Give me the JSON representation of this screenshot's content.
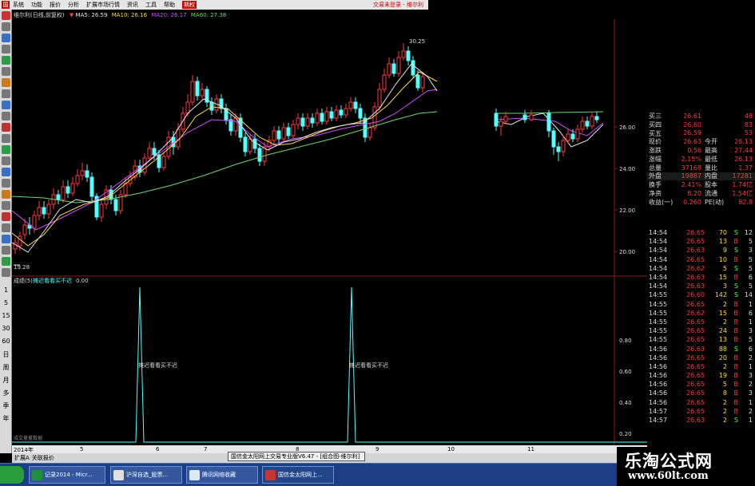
{
  "menubar": {
    "items": [
      "系统",
      "功能",
      "报价",
      "分析",
      "扩展市场行情",
      "资讯",
      "工具",
      "帮助",
      "期权"
    ],
    "right_text": "交易未登录 - 维尔利"
  },
  "chart_header": {
    "title": "维尔利(日线,前复权)",
    "ma5": "MA5: 26.59",
    "ma10": "MA10: 26.16",
    "ma20": "MA20: 26.17",
    "ma60": "MA60: 27.38"
  },
  "price_labels": {
    "high": "30.25",
    "low": "19.28"
  },
  "price_axis": [
    "26.00",
    "24.00",
    "22.00",
    "20.00"
  ],
  "indicator": {
    "header_name": "成绩(5)",
    "header_label": "摊迟看看买不迟",
    "header_value": "0.00",
    "annotation_1": "摊迟看看买不迟",
    "annotation_2": "摊迟看看买不迟",
    "axis": [
      "0.80",
      "0.60",
      "0.40",
      "0.20"
    ],
    "footer_text": "成交量量数据"
  },
  "left_periods": [
    "1",
    "5",
    "15",
    "30",
    "60",
    "日",
    "周",
    "月",
    "多",
    "季",
    "年"
  ],
  "period_tabs": [
    "2014年",
    "5",
    "6",
    "7",
    "8",
    "9",
    "10",
    "11"
  ],
  "status": {
    "left": "扩展A",
    "left2": "关联报价",
    "popup": "国信金太阳网上交易专业版V6.47 - [组合图-维尔利]"
  },
  "quote_rows": [
    {
      "label": "买三",
      "value": "26.61",
      "extra_label": "",
      "extra": "48"
    },
    {
      "label": "买四",
      "value": "26.60",
      "extra_label": "",
      "extra": "83"
    },
    {
      "label": "买五",
      "value": "26.59",
      "extra_label": "",
      "extra": "53"
    },
    {
      "label": "现价",
      "value": "26.63",
      "extra_label": "今开",
      "extra": "26.13"
    },
    {
      "label": "涨跌",
      "value": "0.56",
      "extra_label": "最高",
      "extra": "27.44"
    },
    {
      "label": "涨幅",
      "value": "2.15%",
      "extra_label": "最低",
      "extra": "26.13"
    },
    {
      "label": "总量",
      "value": "37168",
      "extra_label": "量比",
      "extra": "1.37"
    },
    {
      "label": "外盘",
      "value": "19887",
      "extra_label": "内盘",
      "extra": "17281"
    },
    {
      "label": "换手",
      "value": "2.41%",
      "extra_label": "股本",
      "extra": "1.74亿"
    },
    {
      "label": "净资",
      "value": "8.20",
      "extra_label": "流通",
      "extra": "1.54亿"
    },
    {
      "label": "收益(一)",
      "value": "0.260",
      "extra_label": "PE(动)",
      "extra": "82.8"
    }
  ],
  "trades": [
    {
      "time": "14:54",
      "price": "26.65",
      "vol": "70",
      "side": "S",
      "num": "12"
    },
    {
      "time": "14:54",
      "price": "26.65",
      "vol": "13",
      "side": "B",
      "num": "5"
    },
    {
      "time": "14:54",
      "price": "26.63",
      "vol": "9",
      "side": "S",
      "num": "3"
    },
    {
      "time": "14:54",
      "price": "26.65",
      "vol": "10",
      "side": "B",
      "num": "5"
    },
    {
      "time": "14:54",
      "price": "26.62",
      "vol": "5",
      "side": "S",
      "num": "5"
    },
    {
      "time": "14:54",
      "price": "26.63",
      "vol": "15",
      "side": "B",
      "num": "6"
    },
    {
      "time": "14:54",
      "price": "26.63",
      "vol": "3",
      "side": "S",
      "num": "5"
    },
    {
      "time": "14:55",
      "price": "26.60",
      "vol": "142",
      "side": "S",
      "num": "14"
    },
    {
      "time": "14:55",
      "price": "26.65",
      "vol": "2",
      "side": "B",
      "num": "1"
    },
    {
      "time": "14:55",
      "price": "26.62",
      "vol": "15",
      "side": "B",
      "num": "6"
    },
    {
      "time": "14:55",
      "price": "26.65",
      "vol": "2",
      "side": "B",
      "num": "1"
    },
    {
      "time": "14:55",
      "price": "26.65",
      "vol": "24",
      "side": "B",
      "num": "3"
    },
    {
      "time": "14:55",
      "price": "26.65",
      "vol": "13",
      "side": "B",
      "num": "5"
    },
    {
      "time": "14:56",
      "price": "26.63",
      "vol": "88",
      "side": "S",
      "num": "6"
    },
    {
      "time": "14:56",
      "price": "26.65",
      "vol": "20",
      "side": "B",
      "num": "2"
    },
    {
      "time": "14:56",
      "price": "26.65",
      "vol": "2",
      "side": "B",
      "num": "1"
    },
    {
      "time": "14:56",
      "price": "26.65",
      "vol": "19",
      "side": "B",
      "num": "3"
    },
    {
      "time": "14:56",
      "price": "26.65",
      "vol": "5",
      "side": "B",
      "num": "2"
    },
    {
      "time": "14:56",
      "price": "26.65",
      "vol": "8",
      "side": "B",
      "num": "3"
    },
    {
      "time": "14:56",
      "price": "26.65",
      "vol": "2",
      "side": "B",
      "num": "1"
    },
    {
      "time": "14:57",
      "price": "26.65",
      "vol": "2",
      "side": "B",
      "num": "2"
    },
    {
      "time": "14:57",
      "price": "26.63",
      "vol": "2",
      "side": "S",
      "num": "1"
    }
  ],
  "taskbar": [
    {
      "label": "记录2014 - Micr..."
    },
    {
      "label": "沪深自选_股票..."
    },
    {
      "label": "腾讯网络收藏"
    },
    {
      "label": "国信金太阳网上..."
    }
  ],
  "watermark": {
    "main": "乐淘公式网",
    "url": "www.60lt.com"
  },
  "colors": {
    "up": "#ff3a3a",
    "down": "#54ffff",
    "ma5": "#e6e6e6",
    "ma10": "#ffd94a",
    "ma20": "#d24cff",
    "ma60": "#6cd86c"
  }
}
